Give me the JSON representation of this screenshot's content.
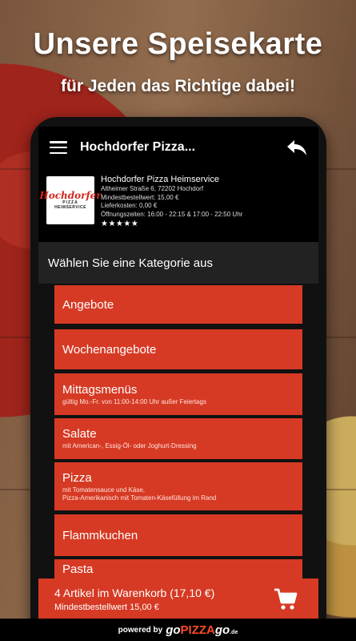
{
  "promo": {
    "headline": "Unsere Speisekarte",
    "subline": "für Jeden das Richtige dabei!"
  },
  "appbar": {
    "title": "Hochdorfer Pizza...",
    "menu_icon": "hamburger-menu-icon",
    "back_icon": "reply-arrow-icon"
  },
  "restaurant": {
    "logo_text": "Hochdorfer",
    "logo_sub1": "PIZZA",
    "logo_sub2": "HEIMSERVICE",
    "name": "Hochdorfer Pizza Heimservice",
    "address": "Altheimer Straße 6, 72202 Hochdorf",
    "min_order": "Mindestbestellwert: 15,00 €",
    "delivery_cost": "Lieferkosten: 0,00 €",
    "hours": "Öffnungszeiten: 16:00 - 22:15 & 17:00 - 22:50 Uhr",
    "rating": 5,
    "stars": "★★★★★"
  },
  "category_header": "Wählen Sie eine Kategorie aus",
  "categories": [
    {
      "title": "Angebote",
      "desc": ""
    },
    {
      "title": "Wochenangebote",
      "desc": ""
    },
    {
      "title": "Mittagsmenüs",
      "desc": "gültig Mo.-Fr. von 11:00-14:00 Uhr außer Feiertags"
    },
    {
      "title": "Salate",
      "desc": "mit American-, Essig-Öl- oder Joghurt-Dressing"
    },
    {
      "title": "Pizza",
      "desc": "mit Tomatensauce und Käse,\nPizza-Amerikanisch mit Tomaten-Käsefüllung im Rand"
    },
    {
      "title": "Flammkuchen",
      "desc": ""
    },
    {
      "title": "Pasta",
      "desc": ""
    }
  ],
  "cart": {
    "summary": "4 Artikel im Warenkorb (17,10 €)",
    "min_order": "Mindestbestellwert 15,00 €",
    "icon": "shopping-cart-icon"
  },
  "footer": {
    "powered": "powered by",
    "brand_go": "go",
    "brand_pizza": "PIZZA",
    "brand_go2": "go",
    "brand_tld": ".de"
  },
  "colors": {
    "accent": "#d63a24",
    "bar": "#000000"
  }
}
